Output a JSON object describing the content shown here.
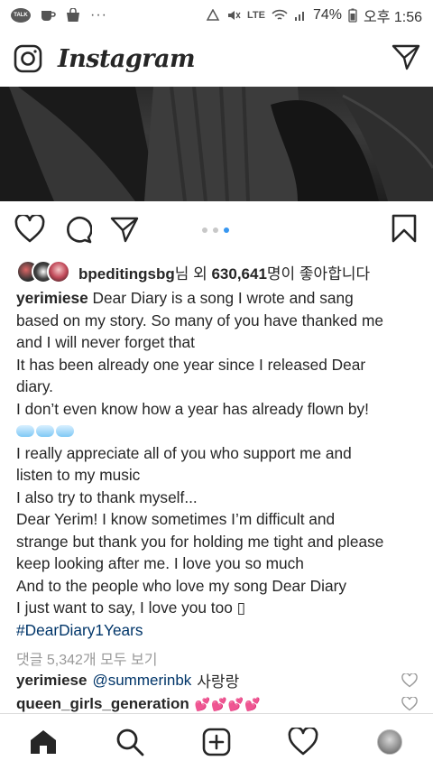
{
  "status_bar": {
    "talk_label": "TALK",
    "more": "···",
    "battery": "74%",
    "time": "오후 1:56",
    "network": "LTE"
  },
  "header": {
    "logo": "Instagram"
  },
  "action_bar": {
    "carousel_total": 3,
    "carousel_active_index": 3
  },
  "likes": {
    "user": "bpeditingsbg",
    "suffix_1": "님 외 ",
    "count": "630,641",
    "suffix_2": "명이 좋아합니다"
  },
  "caption": {
    "username": "yerimiese",
    "lines": [
      " Dear Diary is a song I wrote and sang",
      "based on my story. So many of you have thanked me",
      "and I will never forget that",
      "It has been already one year since I released Dear",
      "diary.",
      "I don’t even know how a year has already flown by!",
      "I really appreciate all of you who support me and",
      "listen to my music",
      "I also try to thank myself...",
      "Dear Yerim! I know sometimes I’m difficult and",
      "strange but thank you for holding me tight and please",
      "keep looking after me. I love you so much",
      "And to the people who love my song Dear Diary",
      "I just want to say, I love you too ▯"
    ],
    "hashtag": "#DearDiary1Years"
  },
  "view_comments": "댓글 5,342개 모두 보기",
  "comments": [
    {
      "user": "yerimiese",
      "mention": "@summerinbk",
      "text": "사랑랑"
    },
    {
      "user": "queen_girls_generation",
      "text": "💕💕💕💕"
    }
  ],
  "colors": {
    "text": "#262626",
    "hashtag": "#003569",
    "muted": "#999999",
    "carousel_active": "#3897f0",
    "divider": "#dbdbdb"
  },
  "icons": [
    "talk-icon",
    "cup-icon",
    "bag-icon",
    "camera-icon",
    "direct-icon",
    "heart-icon",
    "comment-icon",
    "share-icon",
    "bookmark-icon",
    "home-icon",
    "search-icon",
    "add-icon",
    "activity-icon",
    "profile-icon"
  ]
}
